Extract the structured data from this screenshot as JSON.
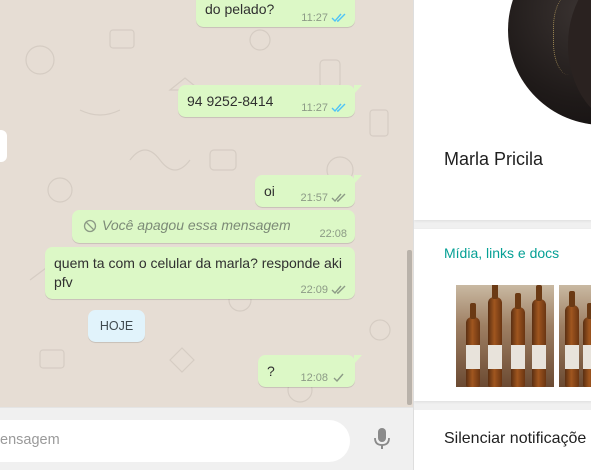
{
  "chat": {
    "messages": [
      {
        "text": "do pelado?",
        "time": "11:27",
        "status": "read"
      },
      {
        "text": "94 9252-8414",
        "time": "11:27",
        "status": "read"
      },
      {
        "text": "oi",
        "time": "21:57",
        "status": "delivered"
      },
      {
        "text": "Você apagou essa mensagem",
        "time": "22:08",
        "status": "deleted"
      },
      {
        "text": "quem ta com o celular da marla? responde aki pfv",
        "time": "22:09",
        "status": "delivered"
      },
      {
        "text": "?",
        "time": "12:08",
        "status": "sent"
      }
    ],
    "day_divider": "HOJE",
    "compose_placeholder": "ensagem"
  },
  "contact": {
    "name": "Marla Pricila"
  },
  "media": {
    "title": "Mídia, links e docs"
  },
  "settings": {
    "mute_label": "Silenciar notificaçõe"
  },
  "colors": {
    "outgoing_bubble": "#dcf8c6",
    "chat_background": "#e6ddd4",
    "accent_teal": "#05a095",
    "read_tick": "#4fc3f7",
    "day_chip": "#e1f3fb"
  },
  "icons": [
    "double-check-icon",
    "single-check-icon",
    "deleted-message-icon",
    "microphone-icon"
  ]
}
